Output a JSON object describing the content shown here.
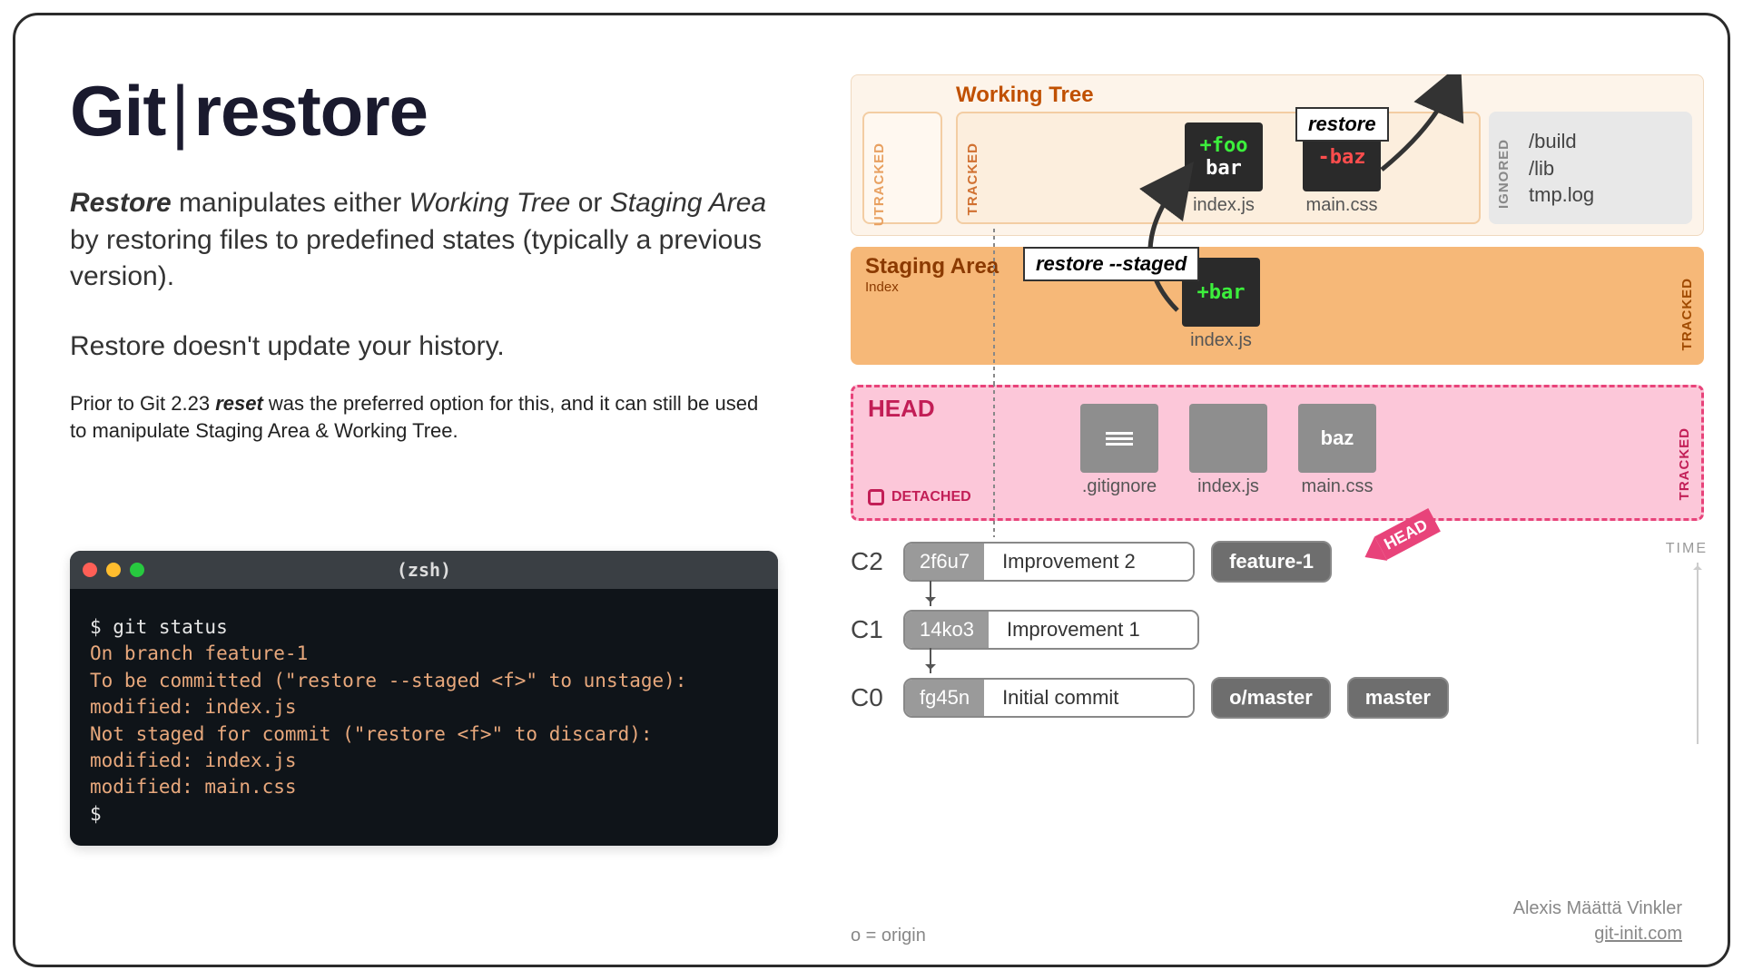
{
  "title": {
    "app": "Git",
    "cmd": "restore"
  },
  "p1": {
    "pre": "Restore",
    "mid": " manipulates either ",
    "em1": "Working Tree",
    "mid2": " or ",
    "em2": "Staging Area",
    "post": " by restoring files to predefined states (typically a previous version)."
  },
  "p2": "Restore doesn't update your history.",
  "p3": {
    "pre": "Prior to Git 2.23 ",
    "b": "reset",
    "post": " was the preferred option for this, and it can still be used to manipulate Staging Area & Working Tree."
  },
  "terminal": {
    "title": "(zsh)",
    "lines": [
      {
        "c": "w",
        "t": "$ git status"
      },
      {
        "c": "o",
        "t": "On branch feature-1"
      },
      {
        "c": "o",
        "t": "To be committed (\"restore --staged <f>\" to unstage):"
      },
      {
        "c": "o",
        "t": "    modified: index.js"
      },
      {
        "c": "o",
        "t": "Not staged for commit (\"restore <f>\" to discard):"
      },
      {
        "c": "o",
        "t": "    modified: index.js"
      },
      {
        "c": "o",
        "t": "    modified: main.css"
      },
      {
        "c": "w",
        "t": "$"
      }
    ]
  },
  "zones": {
    "wt": {
      "title": "Working Tree",
      "utracked": "UTRACKED",
      "tracked": "TRACKED",
      "ignored": "IGNORED",
      "iglist": [
        "/build",
        "/lib",
        "tmp.log"
      ]
    },
    "sa": {
      "title": "Staging Area",
      "sub": "Index",
      "tracked": "TRACKED"
    },
    "head": {
      "title": "HEAD",
      "det": "DETACHED",
      "tracked": "TRACKED"
    }
  },
  "files": {
    "wt1": {
      "l1": "+foo",
      "l2": "bar",
      "cap": "index.js"
    },
    "wt2": {
      "l1": "-baz",
      "cap": "main.css"
    },
    "sa1": {
      "l1": "+bar",
      "cap": "index.js"
    },
    "h1": {
      "cap": ".gitignore"
    },
    "h2": {
      "cap": "index.js"
    },
    "h3": {
      "t": "baz",
      "cap": "main.css"
    }
  },
  "labels": {
    "restore": "restore",
    "restoreStaged": "restore --staged"
  },
  "commits": [
    {
      "id": "C2",
      "hash": "2f6u7",
      "msg": "Improvement 2",
      "tags": [
        "feature-1"
      ]
    },
    {
      "id": "C1",
      "hash": "14ko3",
      "msg": "Improvement 1",
      "tags": []
    },
    {
      "id": "C0",
      "hash": "fg45n",
      "msg": "Initial commit",
      "tags": [
        "o/master",
        "master"
      ]
    }
  ],
  "headTag": "HEAD",
  "time": "TIME",
  "origin": "o = origin",
  "credit": {
    "name": "Alexis Määttä Vinkler",
    "site": "git-init.com"
  }
}
